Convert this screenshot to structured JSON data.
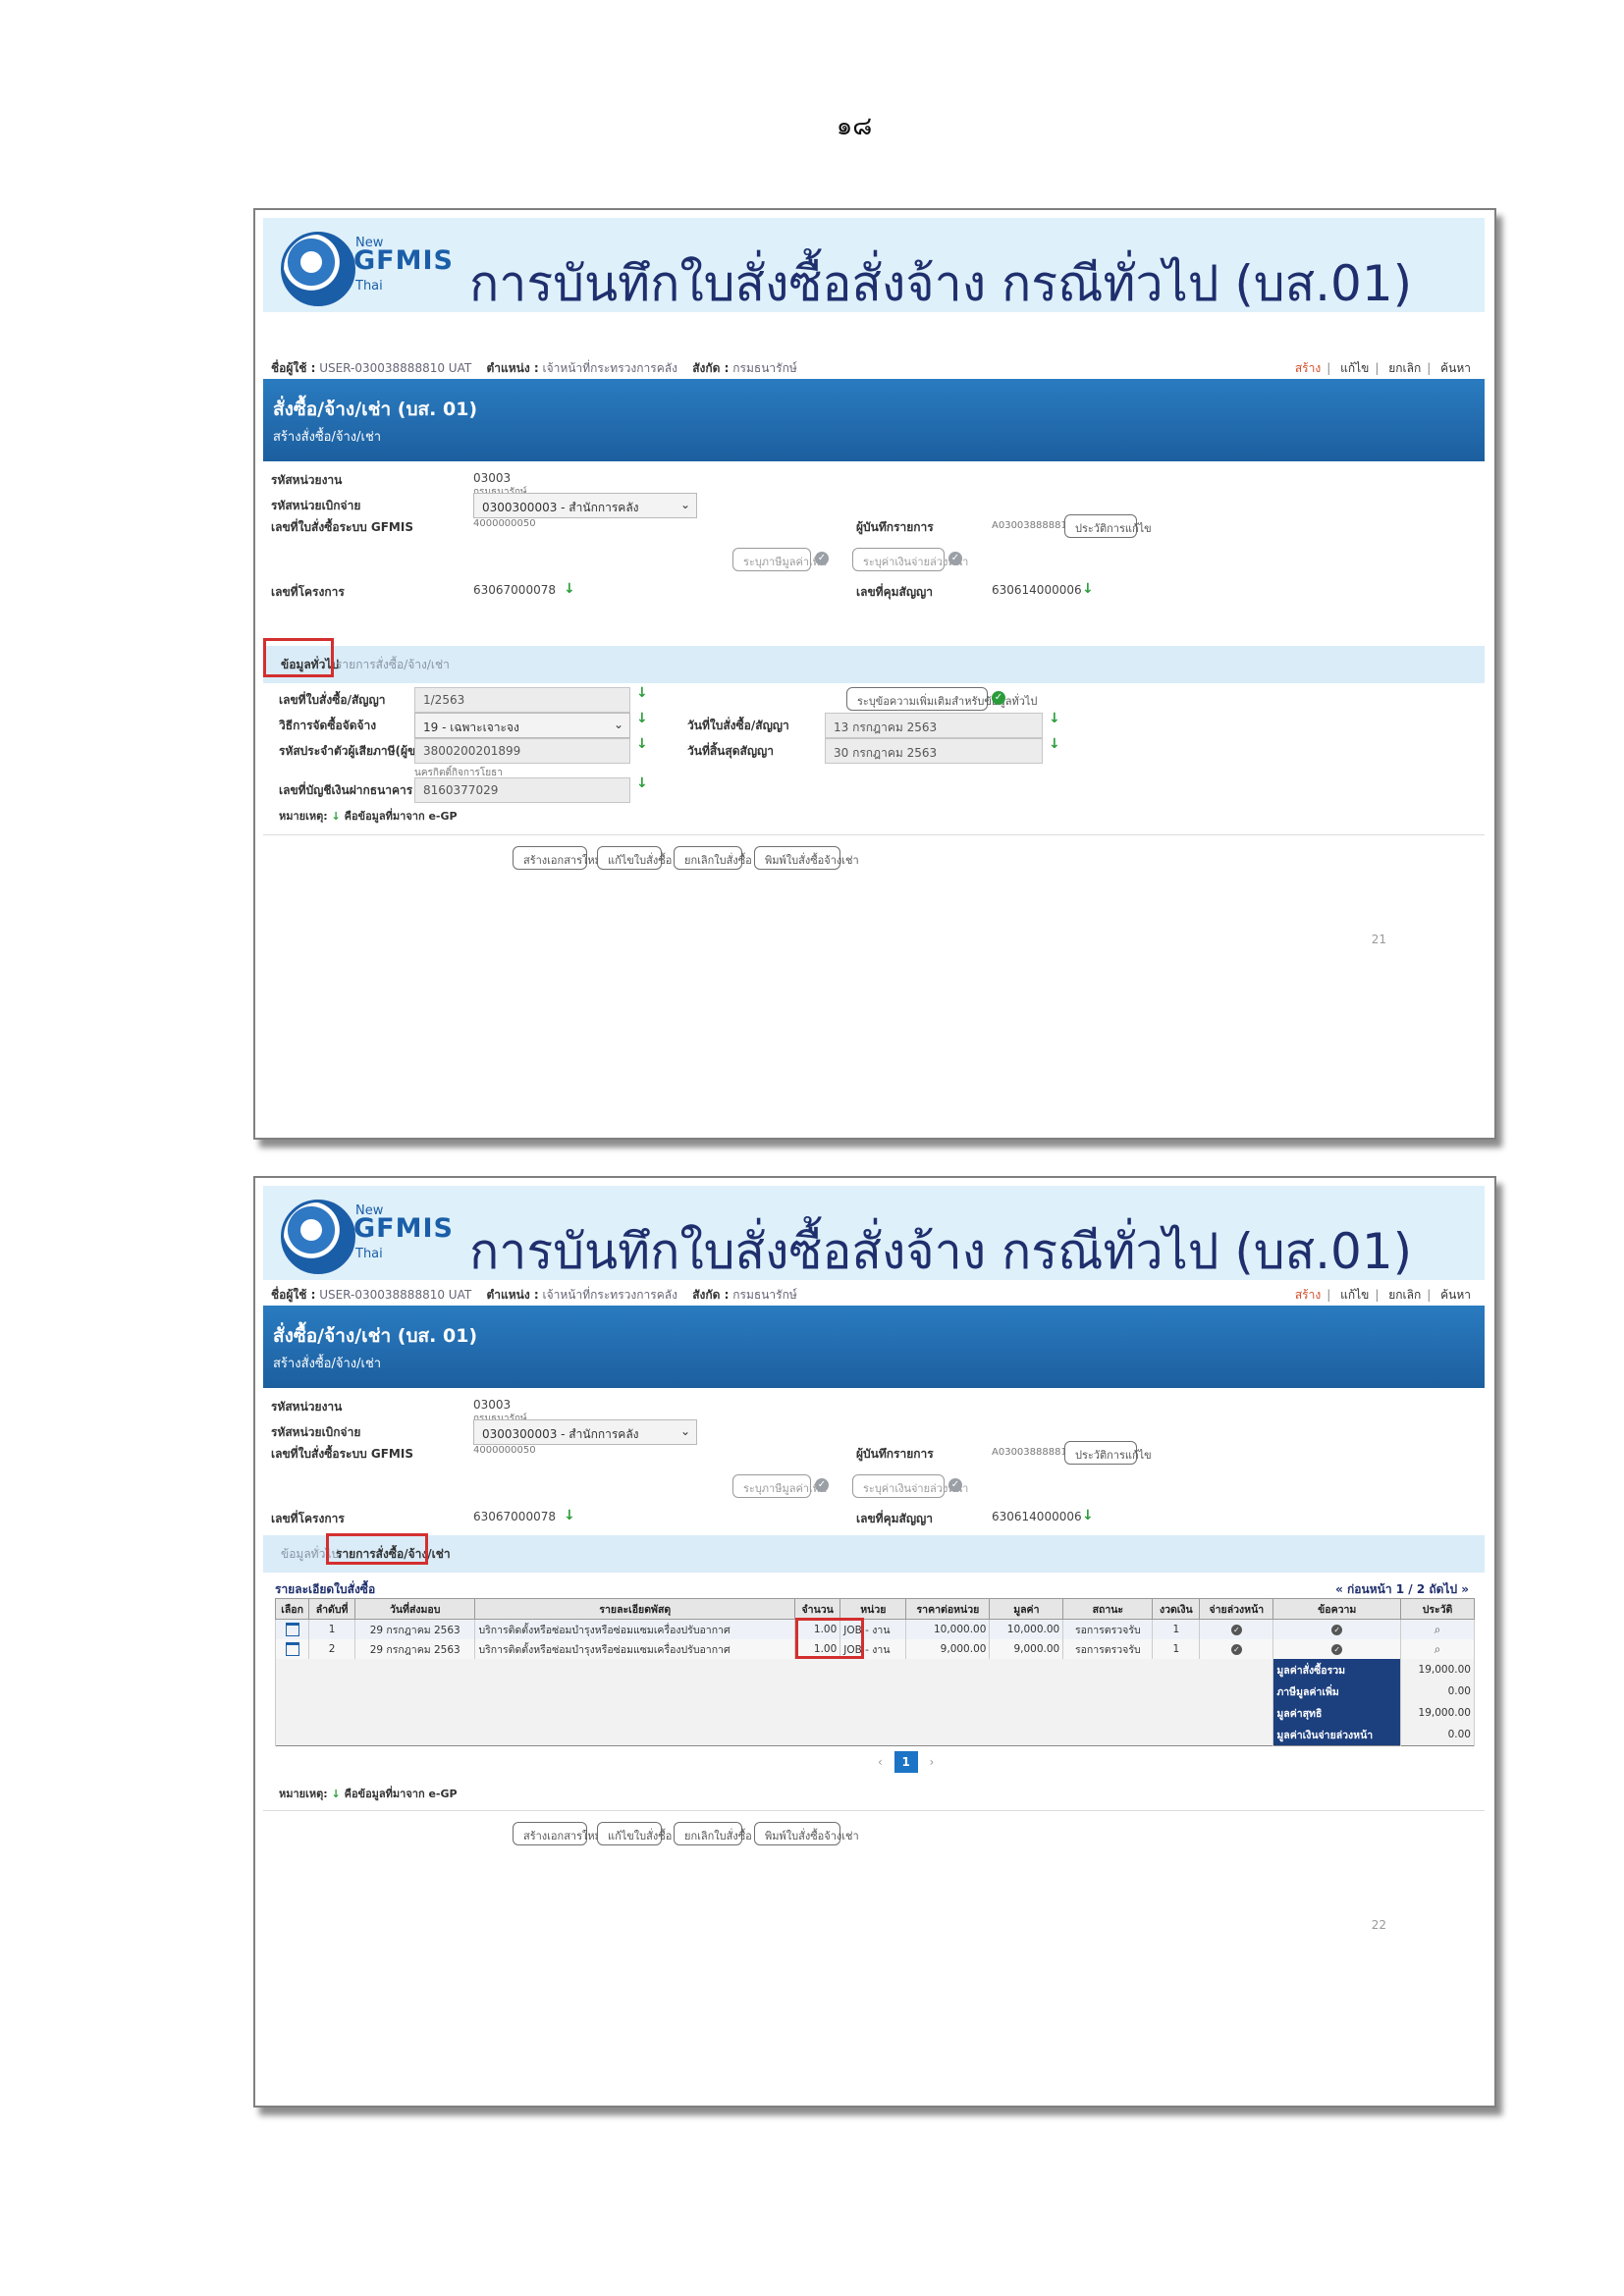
{
  "page": {
    "number": "๑๘"
  },
  "common": {
    "logo": {
      "new": "New",
      "main": "GFMIS",
      "thai": "Thai"
    },
    "title": "การบันทึกใบสั่งซื้อสั่งจ้าง กรณีทั่วไป (บส.01)",
    "user_bar": {
      "user_label": "ชื่อผู้ใช้ :",
      "user_value": "USER-030038888810 UAT",
      "position_label": "ตำแหน่ง :",
      "position_value": "เจ้าหน้าที่กระทรวงการคลัง",
      "affiliation_label": "สังกัด :",
      "affiliation_value": "กรมธนารักษ์",
      "actions": [
        "สร้าง",
        "แก้ไข",
        "ยกเลิก",
        "ค้นหา"
      ]
    },
    "band": {
      "title": "สั่งซื้อ/จ้าง/เช่า (บส. 01)",
      "subtitle": "สร้างสั่งซื้อ/จ้าง/เช่า"
    },
    "fields": {
      "dept_code_label": "รหัสหน่วยงาน",
      "dept_code_value": "03003",
      "dept_code_sub": "กรมธนารักษ์",
      "disb_unit_label": "รหัสหน่วยเบิกจ่าย",
      "disb_unit_value": "0300300003 - สำนักการคลัง",
      "po_gfmis_label": "เลขที่ใบสั่งซื้อระบบ GFMIS",
      "po_gfmis_value": "4000000050",
      "recorder_label": "ผู้บันทึกรายการ",
      "recorder_value": "A03003888881001",
      "history_btn": "ประวัติการแก้ไข",
      "addon_btn": "ระบุภาษีมูลค่าเพิ่ม",
      "advance_btn": "ระบุค่าเงินจ่ายล่วงหน้า",
      "project_label": "เลขที่โครงการ",
      "project_value": "63067000078",
      "control_label": "เลขที่คุมสัญญา",
      "control_value": "630614000006"
    },
    "tabs": [
      "ข้อมูลทั่วไป",
      "รายการสั่งซื้อ/จ้าง/เช่า"
    ],
    "note_label": "หมายเหตุ:",
    "note_text": "คือข้อมูลที่มาจาก e-GP",
    "buttons": [
      "สร้างเอกสารใหม่",
      "แก้ไขใบสั่งซื้อ",
      "ยกเลิกใบสั่งซื้อ",
      "พิมพ์ใบสั่งซื้อจ้างเช่า"
    ]
  },
  "slide1": {
    "number": "21",
    "general": {
      "contract_no_label": "เลขที่ใบสั่งซื้อ/สัญญา",
      "contract_no_value": "1/2563",
      "method_label": "วิธีการจัดซื้อจัดจ้าง",
      "method_value": "19 - เฉพาะเจาะจง",
      "vendor_label": "รหัสประจำตัวผู้เสียภาษี(ผู้ขาย)",
      "vendor_value": "3800200201899",
      "vendor_sub": "นครกิตติ์กิจการโยธา",
      "bank_label": "เลขที่บัญชีเงินฝากธนาคาร",
      "bank_value": "8160377029",
      "extra_btn": "ระบุข้อความเพิ่มเติมสำหรับข้อมูลทั่วไป",
      "po_date_label": "วันที่ใบสั่งซื้อ/สัญญา",
      "po_date_value": "13 กรกฎาคม 2563",
      "end_date_label": "วันที่สิ้นสุดสัญญา",
      "end_date_value": "30 กรกฎาคม 2563"
    }
  },
  "slide2": {
    "number": "22",
    "table_title": "รายละเอียดใบสั่งซื้อ",
    "pager_text": "« ก่อนหน้า 1 / 2 ถัดไป »",
    "columns": [
      "เลือก",
      "ลำดับที่",
      "วันที่ส่งมอบ",
      "รายละเอียดพัสดุ",
      "จำนวน",
      "หน่วย",
      "ราคาต่อหน่วย",
      "มูลค่า",
      "สถานะ",
      "งวดเงิน",
      "จ่ายล่วงหน้า",
      "ข้อความ",
      "ประวัติ"
    ],
    "rows": [
      {
        "no": "1",
        "date": "29 กรกฎาคม 2563",
        "desc": "บริการติดตั้งหรือซ่อมบำรุงหรือซ่อมแซมเครื่องปรับอากาศ",
        "qty": "1.00",
        "unit": "JOB - งาน",
        "price": "10,000.00",
        "amount": "10,000.00",
        "status": "รอการตรวจรับ",
        "period": "1"
      },
      {
        "no": "2",
        "date": "29 กรกฎาคม 2563",
        "desc": "บริการติดตั้งหรือซ่อมบำรุงหรือซ่อมแซมเครื่องปรับอากาศ",
        "qty": "1.00",
        "unit": "JOB - งาน",
        "price": "9,000.00",
        "amount": "9,000.00",
        "status": "รอการตรวจรับ",
        "period": "1"
      }
    ],
    "summary": [
      {
        "label": "มูลค่าสั่งซื้อรวม",
        "value": "19,000.00"
      },
      {
        "label": "ภาษีมูลค่าเพิ่ม",
        "value": "0.00"
      },
      {
        "label": "มูลค่าสุทธิ",
        "value": "19,000.00"
      },
      {
        "label": "มูลค่าเงินจ่ายล่วงหน้า",
        "value": "0.00"
      }
    ],
    "page_prev": "‹",
    "page_current": "1",
    "page_next": "›"
  },
  "colors": {
    "accent": "#1c5f9f",
    "highlight": "#d32f2f",
    "header": "#def0fa"
  }
}
